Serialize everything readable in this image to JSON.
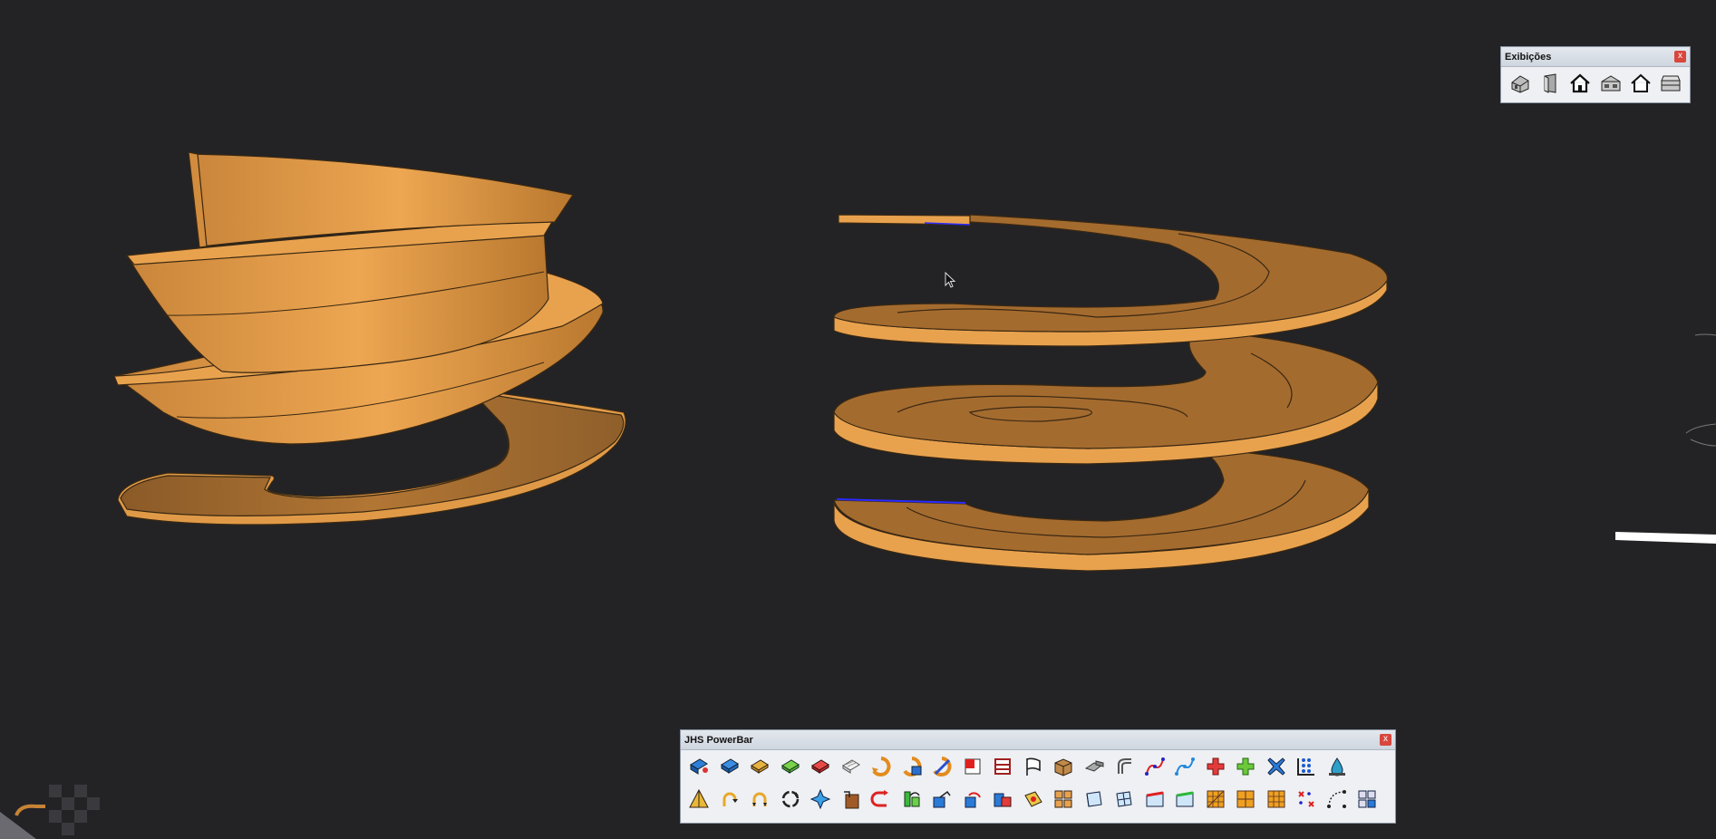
{
  "colors": {
    "background": "#232326",
    "model_face": "#e8a24e",
    "model_side": "#c78336",
    "model_edge": "#3a2812"
  },
  "panels": {
    "exibicoes": {
      "title": "Exibições",
      "close_label": "x",
      "icons": [
        "iso-view-icon",
        "front-view-icon",
        "top-view-icon",
        "right-view-icon",
        "back-view-icon",
        "left-view-icon"
      ]
    },
    "powerbar": {
      "title": "JHS PowerBar",
      "close_label": "x",
      "row1": [
        "tool-1",
        "tool-2",
        "tool-3",
        "tool-4",
        "tool-5",
        "tool-6",
        "tool-7",
        "tool-8",
        "tool-9",
        "tool-10",
        "tool-11",
        "tool-12",
        "tool-13",
        "tool-14",
        "tool-15",
        "tool-16",
        "tool-17",
        "tool-18",
        "tool-19",
        "tool-20",
        "tool-21",
        "tool-22"
      ],
      "row2": [
        "tool-23",
        "tool-24",
        "tool-25",
        "tool-26",
        "tool-27",
        "tool-28",
        "tool-29",
        "tool-30",
        "tool-31",
        "tool-32",
        "tool-33",
        "tool-34",
        "tool-35",
        "tool-36",
        "tool-37",
        "tool-38",
        "tool-39",
        "tool-40",
        "tool-41",
        "tool-42",
        "tool-43",
        "tool-44",
        "tool-45"
      ]
    }
  }
}
